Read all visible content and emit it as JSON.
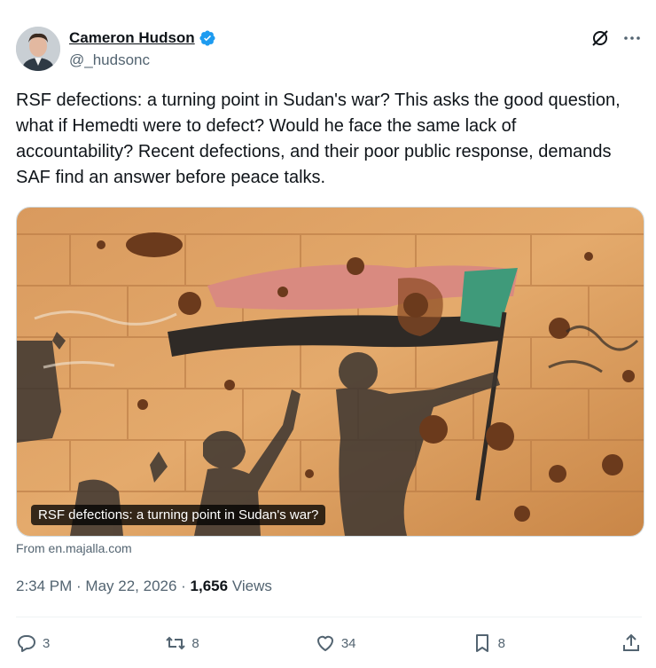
{
  "author": {
    "name": "Cameron Hudson",
    "handle": "@_hudsonc",
    "verified": true
  },
  "tweet": {
    "text": "RSF defections: a turning point in Sudan's war? This asks the good question, what if Hemedti were to defect? Would he face the same lack of accountability? Recent defections, and their poor public response, demands SAF find an answer before peace talks."
  },
  "card": {
    "title": "RSF defections: a turning point in Sudan's war?",
    "from": "From en.majalla.com",
    "image_description_icon": "mural-image"
  },
  "meta": {
    "time": "2:34 PM",
    "separator1": " · ",
    "date": "May 22, 2026",
    "separator2": " · ",
    "views_count": "1,656",
    "views_label": " Views"
  },
  "actions": {
    "replies": "3",
    "reposts": "8",
    "likes": "34",
    "bookmarks": "8"
  },
  "colors": {
    "verified": "#1d9bf0",
    "text": "#0f1419",
    "secondary": "#536471"
  }
}
